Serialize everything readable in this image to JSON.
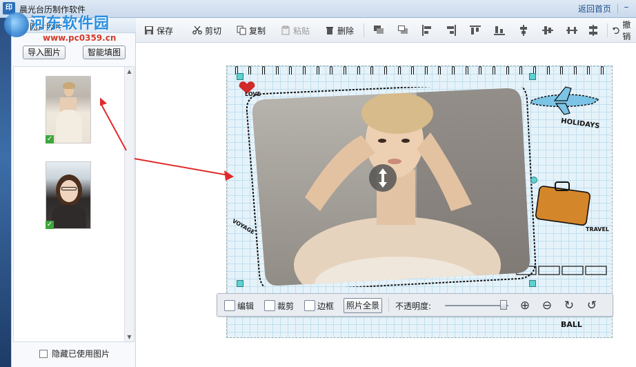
{
  "window": {
    "title": "晨光台历制作软件",
    "icon_text": "印",
    "home_link": "返回首页",
    "minimize": "–"
  },
  "watermark": {
    "title": "河东软件园",
    "url": "www.pc0359.cn"
  },
  "left_panel": {
    "header": "图片照片",
    "import_button": "导入图片",
    "smart_fill_button": "智能填图",
    "hide_used_label": "隐藏已使用图片",
    "thumbnails": [
      {
        "check": "✓"
      },
      {
        "check": "✓"
      }
    ]
  },
  "toolbar": {
    "save": "保存",
    "cut": "剪切",
    "copy": "复制",
    "paste": "粘贴",
    "delete": "删除",
    "undo": "撤销"
  },
  "canvas": {
    "love": "LOVE",
    "holidays": "HOLIDAYS",
    "travel": "TRAVEL",
    "voyage": "VOYAGE",
    "ball": "BALL"
  },
  "photo_toolbar": {
    "edit": "编辑",
    "crop": "裁剪",
    "border": "边框",
    "full_view": "照片全景",
    "opacity_label": "不透明度:",
    "zoom_in_icon": "⊕",
    "zoom_out_icon": "⊖",
    "rotate_right_icon": "↻",
    "rotate_left_icon": "↺"
  },
  "colors": {
    "accent": "#2a6fb8",
    "arrow": "#e02a2a",
    "grid_bg": "#e6f2f9"
  }
}
